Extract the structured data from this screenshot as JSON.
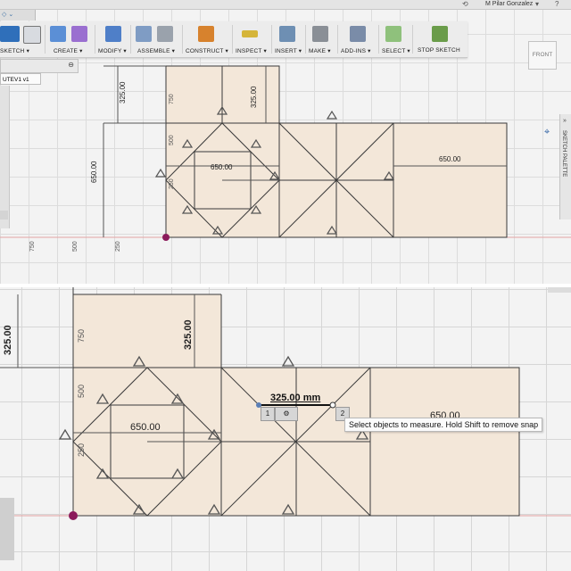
{
  "window": {
    "user": "M Pilar Gonzalez",
    "user_menu": "▾",
    "history": "⟲",
    "help": "?"
  },
  "doc_tab": {
    "label": "◇ ⌄"
  },
  "toolbar": {
    "groups": [
      {
        "label": "SKETCH ▾"
      },
      {
        "label": "CREATE ▾"
      },
      {
        "label": "MODIFY ▾"
      },
      {
        "label": "ASSEMBLE ▾"
      },
      {
        "label": "CONSTRUCT ▾"
      },
      {
        "label": "INSPECT ▾"
      },
      {
        "label": "INSERT ▾"
      },
      {
        "label": "MAKE ▾"
      },
      {
        "label": "ADD-INS ▾"
      },
      {
        "label": "SELECT ▾"
      },
      {
        "label": "STOP SKETCH"
      }
    ],
    "colors": {
      "sketch": "#2f6fba",
      "create": "#5b8fd6",
      "modify": "#4f7fc8",
      "construct": "#d7822d",
      "inspect": "#d5b53a",
      "stop": "#6a9c4a"
    }
  },
  "browser": {
    "component": "UTEV1 v1",
    "close_icon": "⊖"
  },
  "view_cube": {
    "label": "FRONT"
  },
  "palette": {
    "label": "SKETCH PALETTE",
    "icon": "»"
  },
  "top_view": {
    "dims": {
      "d325_left": "325.00",
      "d325_right": "325.00",
      "d650_vertical": "650.00",
      "d650_center": "650.00",
      "d650_right": "650.00"
    },
    "axis_labels": {
      "l750": "750",
      "l500": "500",
      "l250": "250",
      "v750": "750",
      "v500": "500",
      "v250": "250"
    }
  },
  "bottom_view": {
    "dims": {
      "d325_left": "325.00",
      "d325_right": "325.00",
      "d650_center": "650.00",
      "d650_right": "650.00"
    },
    "axis_labels": {
      "v750": "750",
      "v500": "500",
      "v250": "250"
    },
    "measurement": "325.00 mm",
    "badge_1": "1",
    "badge_2": "2",
    "gear_icon": "⚙",
    "tooltip": "Select objects to measure. Hold Shift to remove snap"
  },
  "colors": {
    "sketch_fill": "#f3e7d9",
    "sketch_line": "#333333",
    "axis_red": "#d88",
    "origin": "#8b1a5a"
  }
}
